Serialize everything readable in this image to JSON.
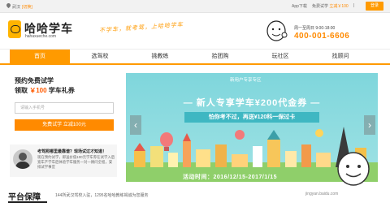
{
  "topbar": {
    "city": "武汉",
    "switch_city": "[切换]",
    "app_download": "App下载",
    "free_trial_label": "免费试学",
    "free_trial_promo": "立减￥100",
    "divider": "|",
    "login": "登录"
  },
  "header": {
    "brand": "哈哈学车",
    "domain": "hahaxueche.com",
    "slogan": "不学车，就考驾，上哈哈学车",
    "hotline_label": "周一至周日 9:00-18:00",
    "hotline": "400-001-6606"
  },
  "nav": {
    "items": [
      {
        "label": "首页",
        "active": true
      },
      {
        "label": "选驾校",
        "active": false
      },
      {
        "label": "挑教练",
        "active": false
      },
      {
        "label": "拾团购",
        "active": false
      },
      {
        "label": "玩社区",
        "active": false
      },
      {
        "label": "找顾问",
        "active": false
      }
    ]
  },
  "trial_form": {
    "title_line1": "预约免费试学",
    "title_line2_prefix": "领取 ",
    "title_line2_price": "￥100",
    "title_line2_suffix": " 学车礼券",
    "phone_placeholder": "请输入手机号",
    "submit_label": "免费试学 立减100元"
  },
  "qa": {
    "title": "考驾照哪里最靠谱？现场试过才知道！",
    "text": "现在预约试学，即送价值100元学车券在试学入后宽车产学车后体验学车服务一对一顾问全程，安排试学事宜"
  },
  "banner": {
    "zone": "新用户专享专区",
    "headline": "— 新人专享学车¥200代金券 —",
    "subline": "怕你考不过，再送¥120科一保过卡",
    "period": "活动时间：2016/12/15-2017/1/15",
    "prev": "‹",
    "next": "›",
    "colors": {
      "sky": "#8fdce0",
      "band": "#3fb7c2"
    }
  },
  "platform": {
    "title": "平台保障",
    "desc": "144所武汉驾校入驻，1295名哈哈教练竭诚为您服务"
  },
  "watermark": {
    "text": "jingyan.baidu.com"
  },
  "colors": {
    "accent": "#ff9a00",
    "price": "#ff5a00"
  }
}
